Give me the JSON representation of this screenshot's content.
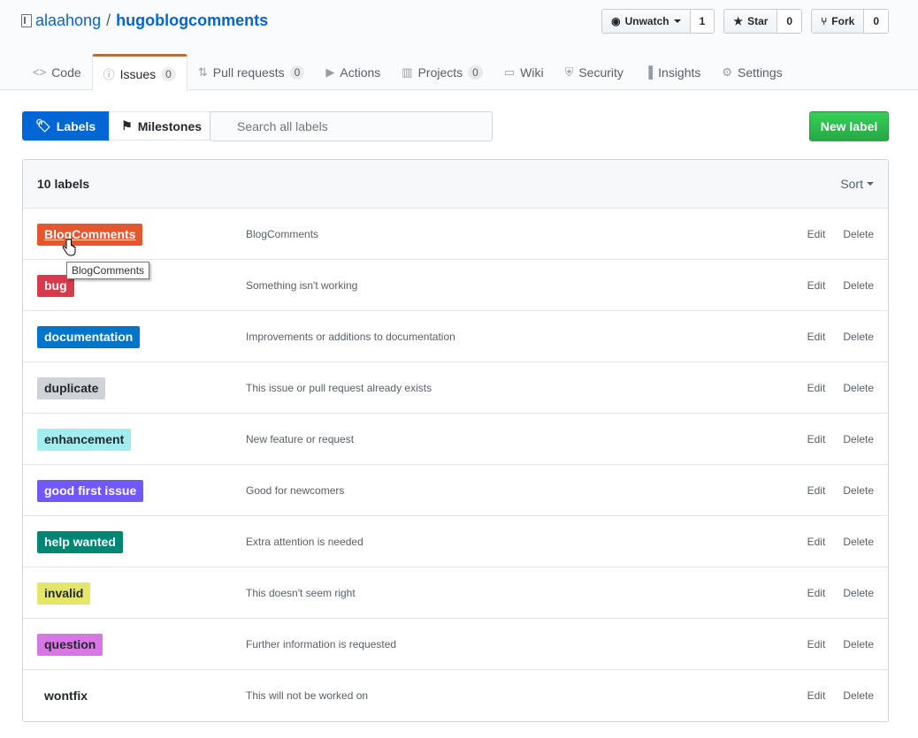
{
  "repo": {
    "owner": "alaahong",
    "separator": "/",
    "name": "hugoblogcomments"
  },
  "repo_actions": [
    {
      "name": "unwatch",
      "label": "Unwatch",
      "icon": "eye-icon",
      "count": "1",
      "has_caret": true
    },
    {
      "name": "star",
      "label": "Star",
      "icon": "star-icon",
      "count": "0"
    },
    {
      "name": "fork",
      "label": "Fork",
      "icon": "fork-icon",
      "count": "0"
    }
  ],
  "tabs": [
    {
      "name": "code",
      "label": "Code",
      "icon": "code-icon"
    },
    {
      "name": "issues",
      "label": "Issues",
      "icon": "issue-icon",
      "count": "0",
      "selected": true
    },
    {
      "name": "pull-requests",
      "label": "Pull requests",
      "icon": "pr-icon",
      "count": "0"
    },
    {
      "name": "actions",
      "label": "Actions",
      "icon": "play-icon"
    },
    {
      "name": "projects",
      "label": "Projects",
      "icon": "project-icon",
      "count": "0"
    },
    {
      "name": "wiki",
      "label": "Wiki",
      "icon": "book-icon"
    },
    {
      "name": "security",
      "label": "Security",
      "icon": "shield-icon"
    },
    {
      "name": "insights",
      "label": "Insights",
      "icon": "graph-icon"
    },
    {
      "name": "settings",
      "label": "Settings",
      "icon": "gear-icon"
    }
  ],
  "subnav": {
    "labels": "Labels",
    "milestones": "Milestones"
  },
  "search": {
    "placeholder": "Search all labels"
  },
  "new_label": "New label",
  "box": {
    "count_text": "10 labels",
    "sort": "Sort"
  },
  "labels": [
    {
      "name": "BlogComments",
      "description": "BlogComments",
      "color": "#e4572e",
      "text_color": "#ffffff",
      "hovered": true
    },
    {
      "name": "bug",
      "description": "Something isn't working",
      "color": "#d73a4a",
      "text_color": "#ffffff"
    },
    {
      "name": "documentation",
      "description": "Improvements or additions to documentation",
      "color": "#0075ca",
      "text_color": "#ffffff"
    },
    {
      "name": "duplicate",
      "description": "This issue or pull request already exists",
      "color": "#cfd3d7",
      "text_color": "#24292e"
    },
    {
      "name": "enhancement",
      "description": "New feature or request",
      "color": "#a2eeef",
      "text_color": "#24292e"
    },
    {
      "name": "good first issue",
      "description": "Good for newcomers",
      "color": "#7057ff",
      "text_color": "#ffffff"
    },
    {
      "name": "help wanted",
      "description": "Extra attention is needed",
      "color": "#008672",
      "text_color": "#ffffff"
    },
    {
      "name": "invalid",
      "description": "This doesn't seem right",
      "color": "#e4e669",
      "text_color": "#24292e"
    },
    {
      "name": "question",
      "description": "Further information is requested",
      "color": "#d876e3",
      "text_color": "#24292e"
    },
    {
      "name": "wontfix",
      "description": "This will not be worked on",
      "color": "#ffffff",
      "text_color": "#24292e"
    }
  ],
  "row_actions": {
    "edit": "Edit",
    "delete": "Delete"
  },
  "tooltip": "BlogComments"
}
